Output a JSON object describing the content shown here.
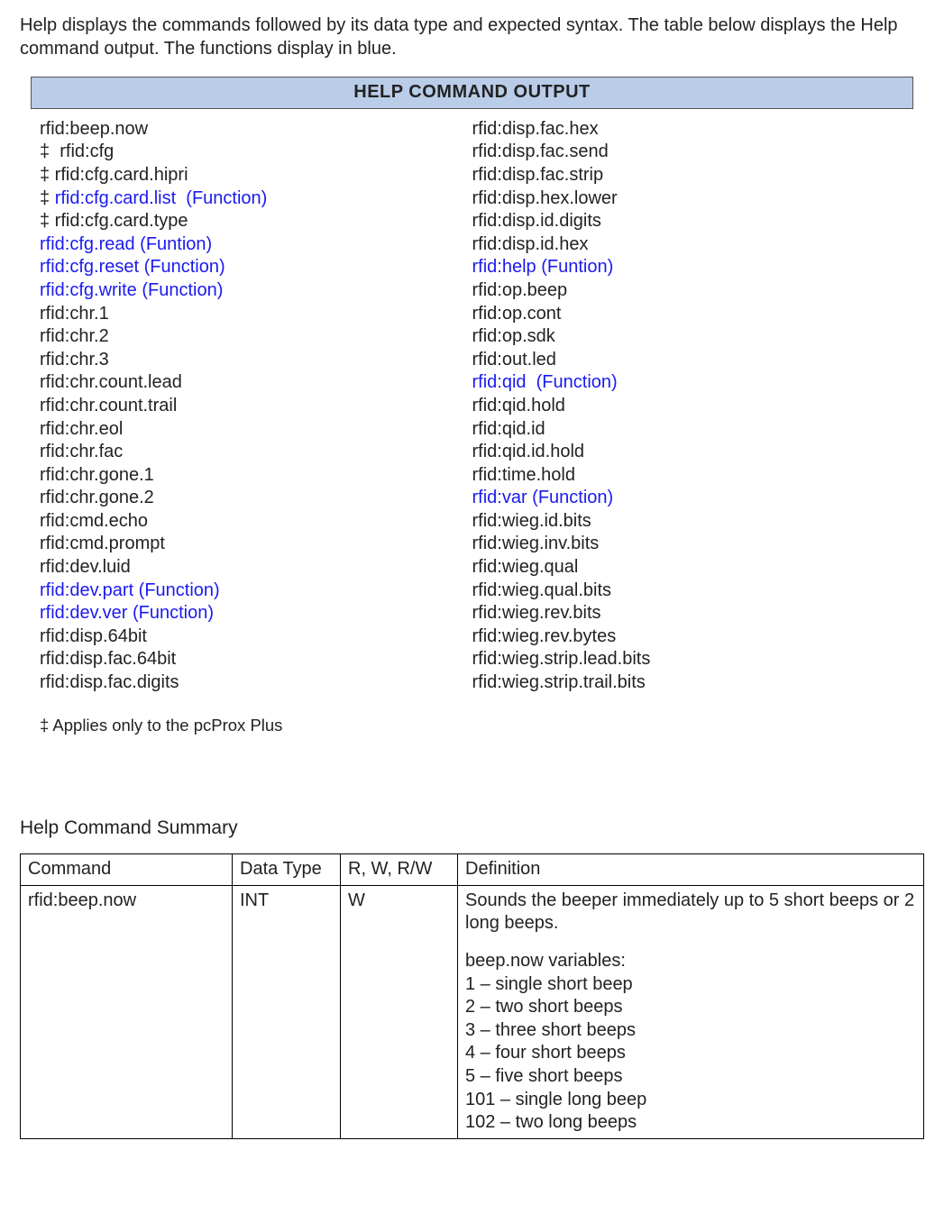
{
  "intro": "Help displays the commands followed by its data type and expected syntax. The table below displays the Help command output. The functions display in blue.",
  "hco_title": "HELP COMMAND OUTPUT",
  "footnote": "‡ Applies only to the pcProx Plus",
  "columns_left": [
    {
      "text": "rfid:beep.now",
      "func": false
    },
    {
      "text": "‡  rfid:cfg",
      "func": false
    },
    {
      "text": "‡ rfid:cfg.card.hipri",
      "func": false
    },
    {
      "text": "‡ rfid:cfg.card.list  (Function)",
      "func": true
    },
    {
      "text": "‡ rfid:cfg.card.type",
      "func": false
    },
    {
      "text": "rfid:cfg.read (Funtion)",
      "func": true
    },
    {
      "text": "rfid:cfg.reset (Function)",
      "func": true
    },
    {
      "text": "rfid:cfg.write (Function)",
      "func": true
    },
    {
      "text": "rfid:chr.1",
      "func": false
    },
    {
      "text": "rfid:chr.2",
      "func": false
    },
    {
      "text": "rfid:chr.3",
      "func": false
    },
    {
      "text": "rfid:chr.count.lead",
      "func": false
    },
    {
      "text": "rfid:chr.count.trail",
      "func": false
    },
    {
      "text": "rfid:chr.eol",
      "func": false
    },
    {
      "text": "rfid:chr.fac",
      "func": false
    },
    {
      "text": "rfid:chr.gone.1",
      "func": false
    },
    {
      "text": "rfid:chr.gone.2",
      "func": false
    },
    {
      "text": "rfid:cmd.echo",
      "func": false
    },
    {
      "text": "rfid:cmd.prompt",
      "func": false
    },
    {
      "text": "rfid:dev.luid",
      "func": false
    },
    {
      "text": "rfid:dev.part (Function)",
      "func": true
    },
    {
      "text": "rfid:dev.ver (Function)",
      "func": true
    },
    {
      "text": "rfid:disp.64bit",
      "func": false
    },
    {
      "text": "rfid:disp.fac.64bit",
      "func": false
    },
    {
      "text": "rfid:disp.fac.digits",
      "func": false
    }
  ],
  "columns_right": [
    {
      "text": "rfid:disp.fac.hex",
      "func": false
    },
    {
      "text": "rfid:disp.fac.send",
      "func": false
    },
    {
      "text": "rfid:disp.fac.strip",
      "func": false
    },
    {
      "text": "rfid:disp.hex.lower",
      "func": false
    },
    {
      "text": "rfid:disp.id.digits",
      "func": false
    },
    {
      "text": "rfid:disp.id.hex",
      "func": false
    },
    {
      "text": "rfid:help (Funtion)",
      "func": true
    },
    {
      "text": "rfid:op.beep",
      "func": false
    },
    {
      "text": "rfid:op.cont",
      "func": false
    },
    {
      "text": "rfid:op.sdk",
      "func": false
    },
    {
      "text": "rfid:out.led",
      "func": false
    },
    {
      "text": "rfid:qid  (Function)",
      "func": true
    },
    {
      "text": "rfid:qid.hold",
      "func": false
    },
    {
      "text": "rfid:qid.id",
      "func": false
    },
    {
      "text": "rfid:qid.id.hold",
      "func": false
    },
    {
      "text": "rfid:time.hold",
      "func": false
    },
    {
      "text": "rfid:var (Function)",
      "func": true
    },
    {
      "text": "rfid:wieg.id.bits",
      "func": false
    },
    {
      "text": "rfid:wieg.inv.bits",
      "func": false
    },
    {
      "text": "rfid:wieg.qual",
      "func": false
    },
    {
      "text": "rfid:wieg.qual.bits",
      "func": false
    },
    {
      "text": "rfid:wieg.rev.bits",
      "func": false
    },
    {
      "text": "rfid:wieg.rev.bytes",
      "func": false
    },
    {
      "text": "rfid:wieg.strip.lead.bits",
      "func": false
    },
    {
      "text": "rfid:wieg.strip.trail.bits",
      "func": false
    }
  ],
  "summary_header": "Help Command Summary",
  "table": {
    "headers": [
      "Command",
      "Data Type",
      "R, W, R/W",
      "Definition"
    ],
    "row": {
      "command": "rfid:beep.now",
      "datatype": "INT",
      "rw": "W",
      "def_p1": "Sounds the beeper immediately  up to 5 short beeps or 2 long beeps.",
      "def_p2": "beep.now variables:\n1 – single short beep\n2 – two short beeps\n3 – three short beeps\n4 – four short beeps\n5 – five short beeps\n101 – single long beep\n102 – two long beeps"
    }
  }
}
